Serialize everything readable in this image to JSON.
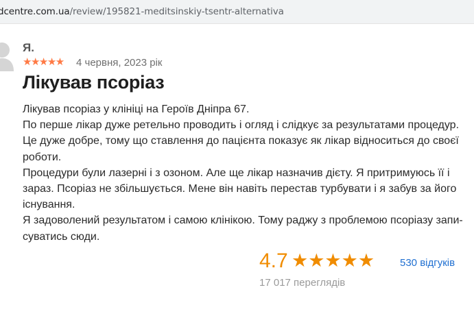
{
  "browser": {
    "url_domain": "dcentre.com.ua",
    "url_path": "/review/195821-meditsinskiy-tsentr-alternativa"
  },
  "review": {
    "author": "Я.",
    "rating": 5,
    "stars_glyphs": "★★★★★",
    "date": "4 червня, 2023 рік",
    "title": "Лікував псоріаз",
    "lines": [
      "Лікував псоріаз у клініці на Героїв Дніпра 67.",
      "По перше лікар дуже ретельно проводить і огляд і слідкує за результатами процедур.",
      "Це дуже добре, тому що ставлення до пацієнта показує як лікар відноситься до своєї",
      "роботи.",
      "Процедури були лазерні і з озоном. Але ще лікар назначив дієту. Я притримуюсь її і",
      "зараз. Псоріаз не збільшується. Мене він навіть перестав турбувати і я забув за його",
      "існування.",
      "Я задоволений результатом і самою клінікою. Тому раджу з проблемою псоріазу запи-",
      "суватись сюди."
    ]
  },
  "summary": {
    "rating_value": "4.7",
    "stars_glyphs": "★★★★★",
    "reviews_count_label": "530 відгуків",
    "views_label": "17 017 переглядів"
  },
  "colors": {
    "review_star": "#ff7a45",
    "summary_accent": "#f08c00",
    "link": "#1f6fd1"
  },
  "icons": {
    "avatar": "user-avatar-icon",
    "star": "star-icon"
  }
}
